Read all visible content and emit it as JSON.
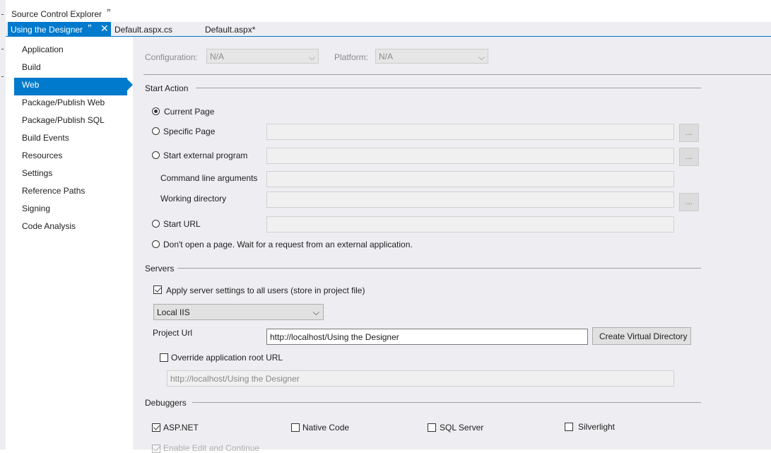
{
  "header": {
    "panel_title": "Source Control Explorer",
    "pin_icon": "pin-icon",
    "tabs": [
      {
        "label": "Using the Designer",
        "active": true
      },
      {
        "label": "Default.aspx.cs",
        "active": false
      },
      {
        "label": "Default.aspx*",
        "active": false
      }
    ],
    "close_glyph": "✕",
    "pin_glyph": "ꟸ"
  },
  "nav": {
    "items": [
      "Application",
      "Build",
      "Web",
      "Package/Publish Web",
      "Package/Publish SQL",
      "Build Events",
      "Resources",
      "Settings",
      "Reference Paths",
      "Signing",
      "Code Analysis"
    ],
    "selected": "Web"
  },
  "config": {
    "configuration_label": "Configuration:",
    "configuration_value": "N/A",
    "platform_label": "Platform:",
    "platform_value": "N/A"
  },
  "start_action": {
    "title": "Start Action",
    "current_page": "Current Page",
    "specific_page": "Specific Page",
    "start_external_program": "Start external program",
    "command_line_arguments": "Command line arguments",
    "working_directory": "Working directory",
    "start_url": "Start URL",
    "dont_open": "Don't open a page.  Wait for a request from an external application.",
    "browse_label": "...",
    "selected": "Current Page"
  },
  "servers": {
    "title": "Servers",
    "apply_label": "Apply server settings to all users (store in project file)",
    "apply_checked": true,
    "server_value": "Local IIS",
    "project_url_label": "Project Url",
    "project_url_value": "http://localhost/Using the Designer",
    "create_vdir_label": "Create Virtual Directory",
    "override_label": "Override application root URL",
    "override_checked": false,
    "override_value": "http://localhost/Using the Designer"
  },
  "debuggers": {
    "title": "Debuggers",
    "aspnet": "ASP.NET",
    "native": "Native Code",
    "sql": "SQL Server",
    "silverlight": "Silverlight",
    "edit_continue": "Enable Edit and Continue"
  },
  "chev": "⌵"
}
